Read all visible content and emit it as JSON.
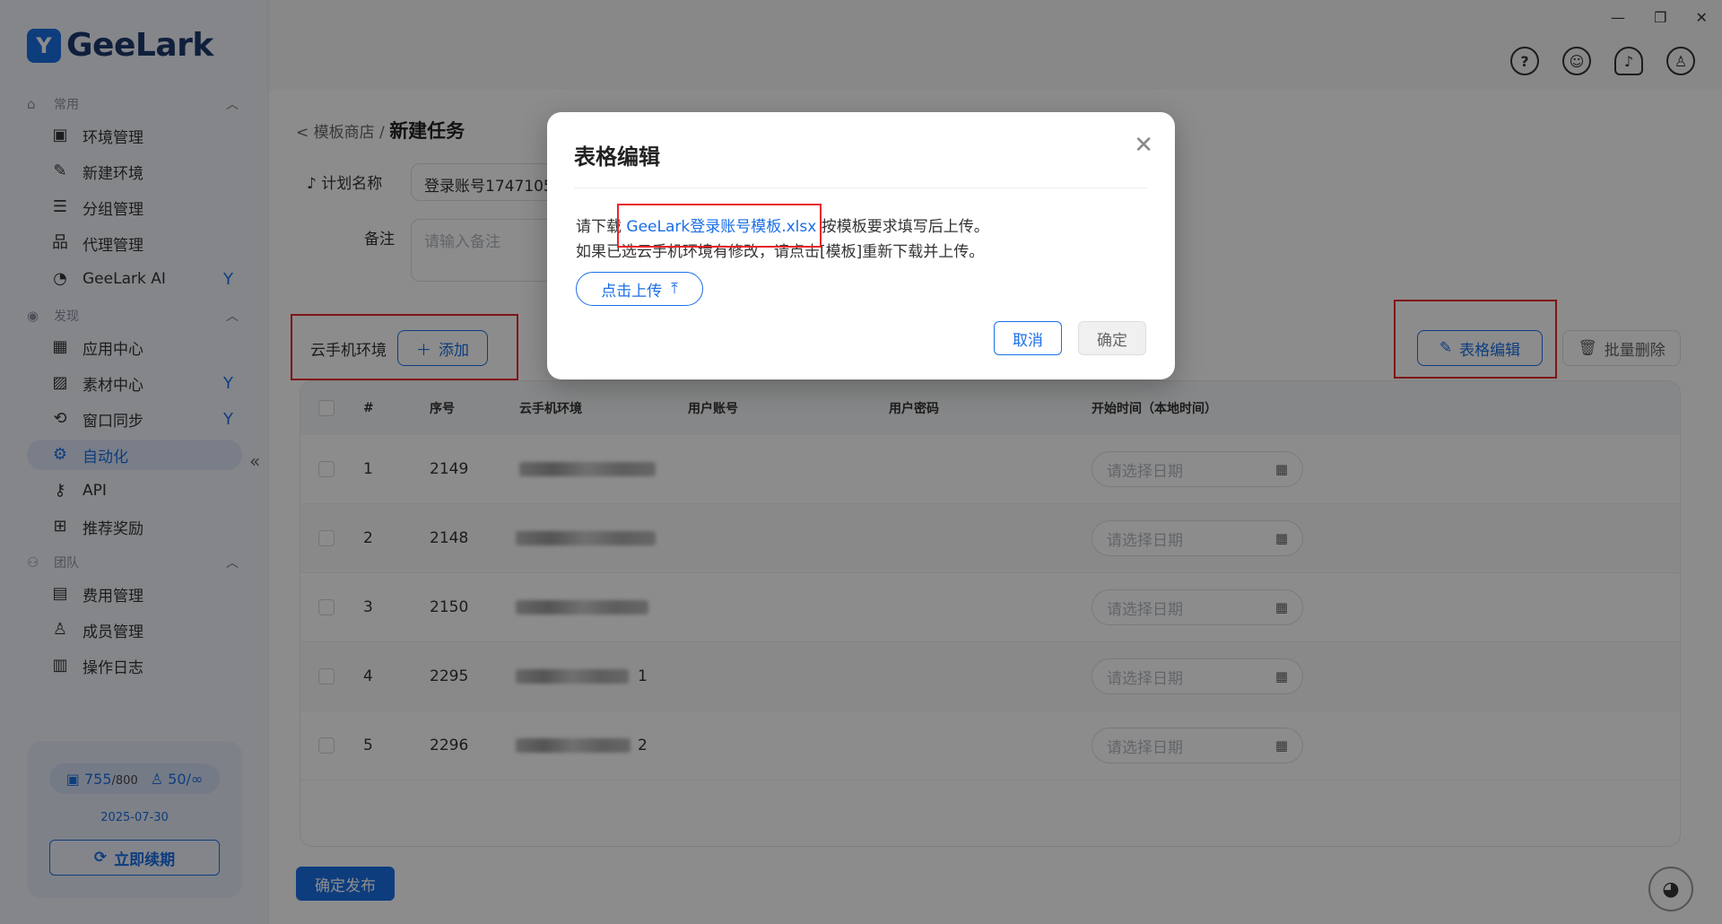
{
  "app": {
    "logo_text": "GeeLark"
  },
  "sidebar": {
    "sections": [
      {
        "label": "常用"
      },
      {
        "label": "发现"
      },
      {
        "label": "团队"
      }
    ],
    "items": [
      {
        "label": "环境管理"
      },
      {
        "label": "新建环境"
      },
      {
        "label": "分组管理"
      },
      {
        "label": "代理管理"
      },
      {
        "label": "GeeLark AI"
      },
      {
        "label": "应用中心"
      },
      {
        "label": "素材中心"
      },
      {
        "label": "窗口同步"
      },
      {
        "label": "自动化"
      },
      {
        "label": "API"
      },
      {
        "label": "推荐奖励"
      },
      {
        "label": "费用管理"
      },
      {
        "label": "成员管理"
      },
      {
        "label": "操作日志"
      }
    ],
    "quota": {
      "envs": "755",
      "envs_max": "/800",
      "members": "50/∞",
      "expire": "2025-07-30",
      "renew_label": "立即续期"
    }
  },
  "breadcrumb": {
    "parent": "< 模板商店 /",
    "current": "新建任务"
  },
  "form": {
    "plan_label": "计划名称",
    "plan_value": "登录账号1747105",
    "note_label": "备注",
    "note_placeholder": "请输入备注"
  },
  "env": {
    "label": "云手机环境",
    "add_label": "添加",
    "edit_label": "表格编辑",
    "delete_label": "批量删除"
  },
  "table": {
    "headers": [
      "#",
      "序号",
      "云手机环境",
      "用户账号",
      "用户密码",
      "开始时间（本地时间）"
    ],
    "rows": [
      {
        "idx": "1",
        "serial": "2149",
        "suffix": ""
      },
      {
        "idx": "2",
        "serial": "2148",
        "suffix": ""
      },
      {
        "idx": "3",
        "serial": "2150",
        "suffix": ""
      },
      {
        "idx": "4",
        "serial": "2295",
        "suffix": "1"
      },
      {
        "idx": "5",
        "serial": "2296",
        "suffix": "2"
      }
    ],
    "date_placeholder": "请选择日期"
  },
  "publish_label": "确定发布",
  "modal": {
    "title": "表格编辑",
    "line1_prefix": "请下载",
    "link": "GeeLark登录账号模板.xlsx",
    "line1_suffix": "按模板要求填写后上传。",
    "line2": "如果已选云手机环境有修改，请点击[模板]重新下载并上传。",
    "upload_label": "点击上传",
    "cancel_label": "取消",
    "ok_label": "确定"
  },
  "colors": {
    "accent": "#1b6fe6",
    "highlight": "#e8262a"
  }
}
